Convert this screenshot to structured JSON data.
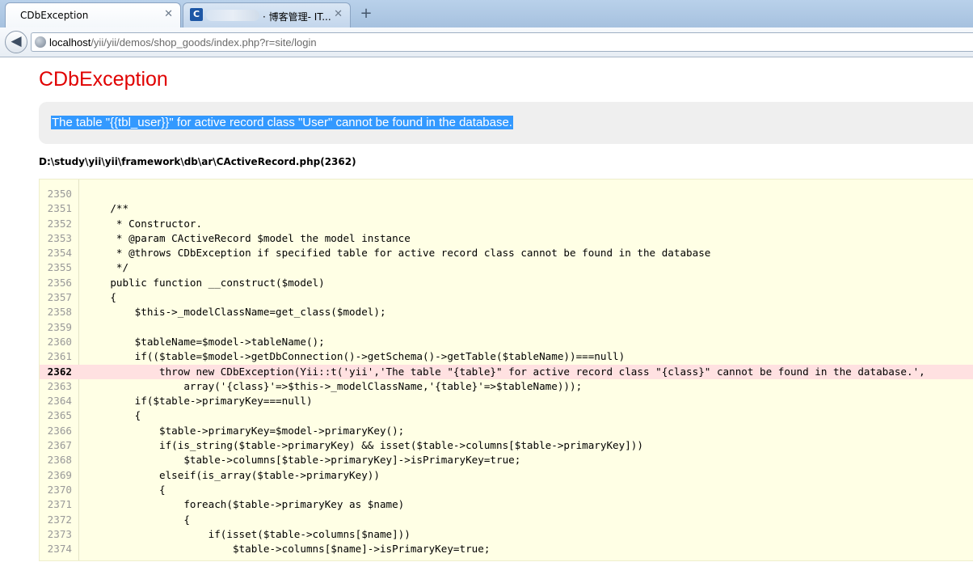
{
  "browser": {
    "tabs": [
      {
        "label": "CDbException",
        "active": true
      },
      {
        "label": "· 博客管理- IT...",
        "active": false
      }
    ],
    "new_tab_icon": "plus-icon",
    "address": {
      "host": "localhost",
      "path": "/yii/yii/demos/shop_goods/index.php?r=site/login"
    }
  },
  "page": {
    "title": "CDbException",
    "message": "The table \"{{tbl_user}}\" for active record class \"User\" cannot be found in the database.",
    "file_path": "D:\\study\\yii\\yii\\framework\\db\\ar\\CActiveRecord.php(2362)",
    "error_line": 2362,
    "source_lines": [
      {
        "num": "2350",
        "code": ""
      },
      {
        "num": "2351",
        "code": "    /**"
      },
      {
        "num": "2352",
        "code": "     * Constructor."
      },
      {
        "num": "2353",
        "code": "     * @param CActiveRecord $model the model instance"
      },
      {
        "num": "2354",
        "code": "     * @throws CDbException if specified table for active record class cannot be found in the database"
      },
      {
        "num": "2355",
        "code": "     */"
      },
      {
        "num": "2356",
        "code": "    public function __construct($model)"
      },
      {
        "num": "2357",
        "code": "    {"
      },
      {
        "num": "2358",
        "code": "        $this->_modelClassName=get_class($model);"
      },
      {
        "num": "2359",
        "code": ""
      },
      {
        "num": "2360",
        "code": "        $tableName=$model->tableName();"
      },
      {
        "num": "2361",
        "code": "        if(($table=$model->getDbConnection()->getSchema()->getTable($tableName))===null)"
      },
      {
        "num": "2362",
        "code": "            throw new CDbException(Yii::t('yii','The table \"{table}\" for active record class \"{class}\" cannot be found in the database.',"
      },
      {
        "num": "2363",
        "code": "                array('{class}'=>$this->_modelClassName,'{table}'=>$tableName)));"
      },
      {
        "num": "2364",
        "code": "        if($table->primaryKey===null)"
      },
      {
        "num": "2365",
        "code": "        {"
      },
      {
        "num": "2366",
        "code": "            $table->primaryKey=$model->primaryKey();"
      },
      {
        "num": "2367",
        "code": "            if(is_string($table->primaryKey) && isset($table->columns[$table->primaryKey]))"
      },
      {
        "num": "2368",
        "code": "                $table->columns[$table->primaryKey]->isPrimaryKey=true;"
      },
      {
        "num": "2369",
        "code": "            elseif(is_array($table->primaryKey))"
      },
      {
        "num": "2370",
        "code": "            {"
      },
      {
        "num": "2371",
        "code": "                foreach($table->primaryKey as $name)"
      },
      {
        "num": "2372",
        "code": "                {"
      },
      {
        "num": "2373",
        "code": "                    if(isset($table->columns[$name]))"
      },
      {
        "num": "2374",
        "code": "                        $table->columns[$name]->isPrimaryKey=true;"
      }
    ]
  }
}
